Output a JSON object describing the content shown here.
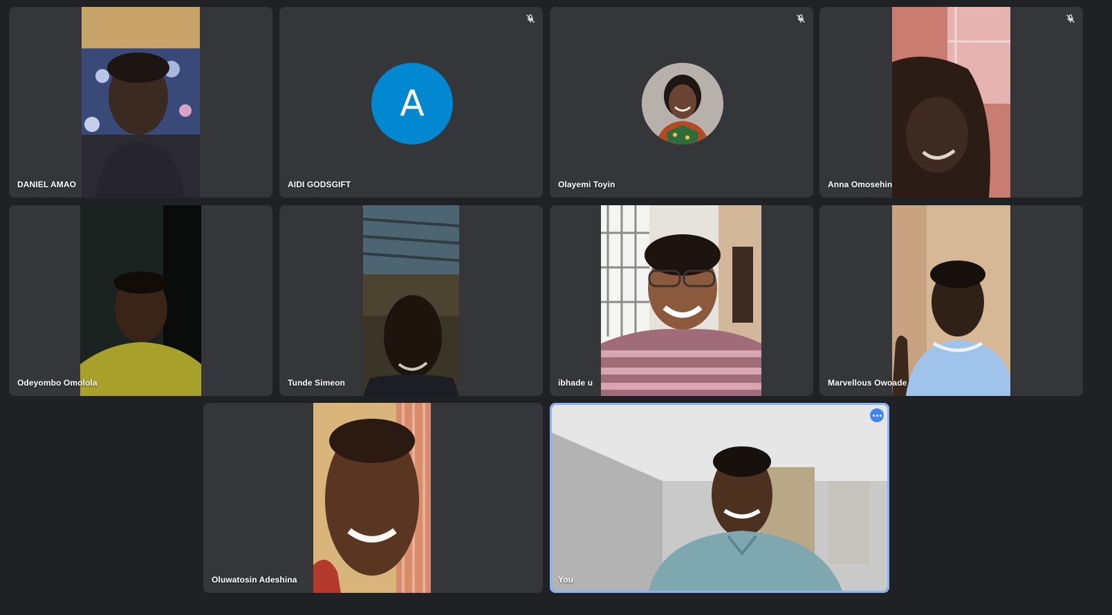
{
  "meeting": {
    "participants": [
      {
        "name": "DANIEL AMAO",
        "muted": false,
        "display": "video"
      },
      {
        "name": "AIDI GODSGIFT",
        "muted": true,
        "display": "avatar-letter",
        "avatar_letter": "A",
        "avatar_color": "#0288d1"
      },
      {
        "name": "Olayemi Toyin",
        "muted": true,
        "display": "avatar-photo"
      },
      {
        "name": "Anna Omosehin",
        "muted": true,
        "display": "video"
      },
      {
        "name": "Odeyombo Omolola",
        "muted": false,
        "display": "video"
      },
      {
        "name": "Tunde Simeon",
        "muted": false,
        "display": "video"
      },
      {
        "name": "ibhade u",
        "muted": false,
        "display": "video"
      },
      {
        "name": "Marvellous Owoade",
        "muted": false,
        "display": "video"
      },
      {
        "name": "Oluwatosin Adeshina",
        "muted": false,
        "display": "video"
      },
      {
        "name": "You",
        "muted": false,
        "display": "video",
        "self": true
      }
    ]
  },
  "icons": {
    "mic_off": "mic-off-icon",
    "more": "more-options-icon"
  },
  "colors": {
    "background": "#202124",
    "tile": "#35363a",
    "active_border": "#8ab4f8",
    "accent": "#4285f4"
  }
}
